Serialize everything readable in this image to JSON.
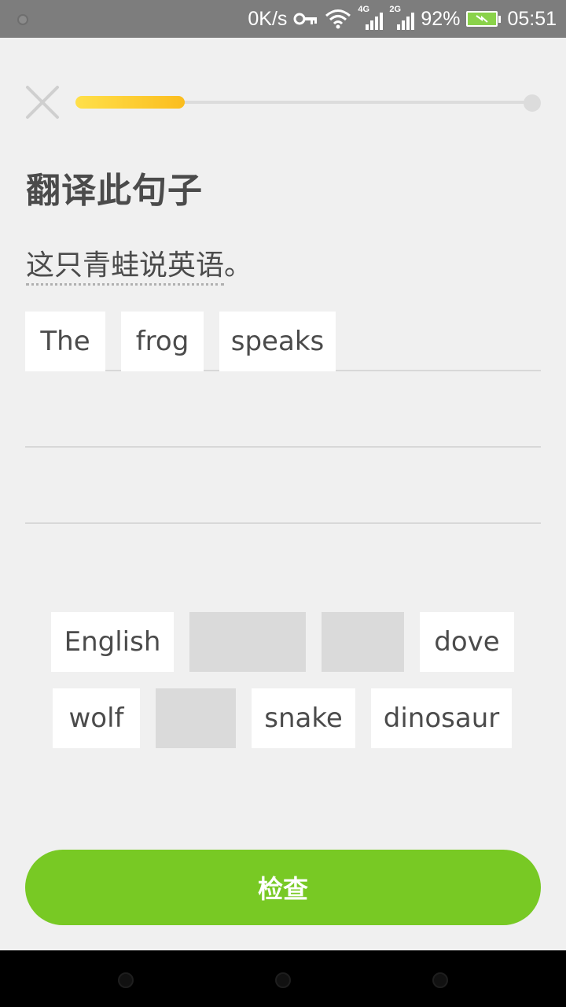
{
  "status_bar": {
    "net_speed": "0K/s",
    "net1": "4G",
    "net2": "2G",
    "battery": "92%",
    "time": "05:51",
    "icons": [
      "key-icon",
      "wifi-icon",
      "signal-icon",
      "battery-charging-icon"
    ]
  },
  "lesson": {
    "progress_fraction": 0.24,
    "title": "翻译此句子",
    "prompt": "这只青蛙说英语",
    "prompt_punct": "。"
  },
  "answer": {
    "words": [
      "The",
      "frog",
      "speaks"
    ]
  },
  "word_bank": {
    "row1": [
      "English",
      "",
      "",
      "dove"
    ],
    "row2": [
      "wolf",
      "",
      "snake",
      "dinosaur"
    ]
  },
  "check_button": {
    "label": "检查"
  },
  "colors": {
    "accent_green": "#78c924",
    "progress_yellow": "#fbbd1e",
    "background": "#f0f0f0"
  }
}
